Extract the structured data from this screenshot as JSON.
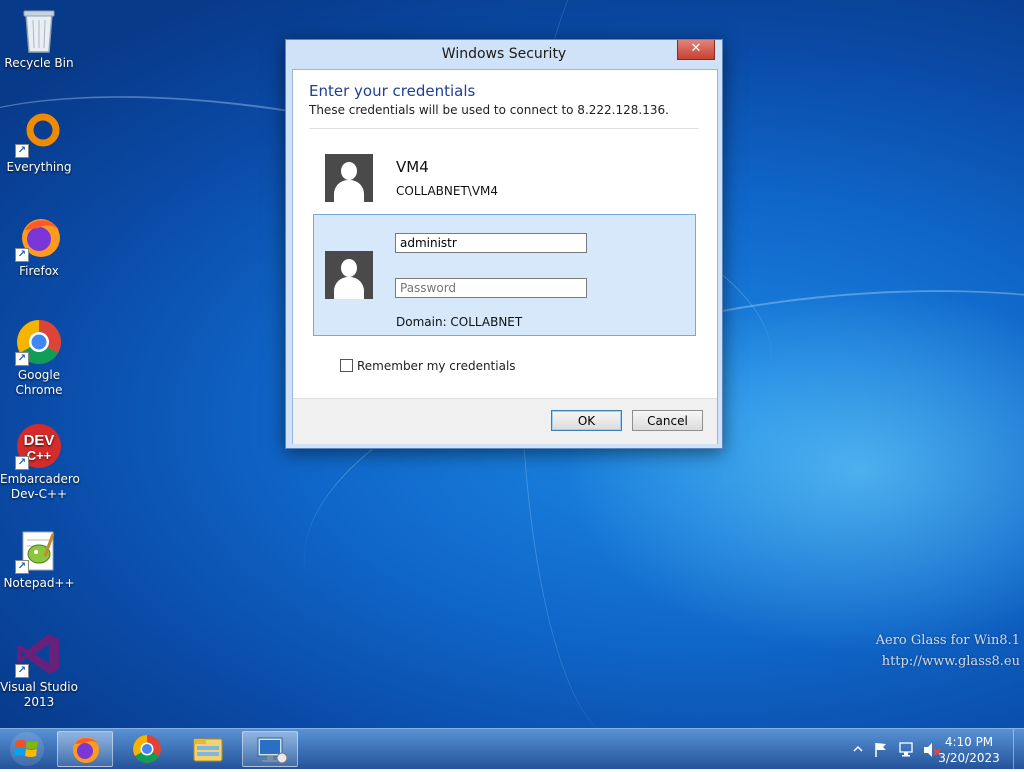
{
  "desktop": {
    "icons": [
      {
        "label": "Recycle Bin"
      },
      {
        "label": "Everything"
      },
      {
        "label": "Firefox"
      },
      {
        "label": "Google Chrome"
      },
      {
        "label": "Embarcadero Dev-C++"
      },
      {
        "label": "Notepad++"
      },
      {
        "label": "Visual Studio 2013"
      }
    ],
    "watermark": {
      "line1": "Aero Glass for Win8.1",
      "line2": "http://www.glass8.eu"
    }
  },
  "dialog": {
    "title": "Windows Security",
    "close_label": "✕",
    "heading": "Enter your credentials",
    "subtext": "These credentials will be used to connect to 8.222.128.136.",
    "account": {
      "name": "VM4",
      "domain_user": "COLLABNET\\VM4"
    },
    "form": {
      "username_value": "administr",
      "password_placeholder": "Password",
      "domain_label": "Domain: COLLABNET"
    },
    "remember_label": "Remember my credentials",
    "remember_checked": false,
    "ok_label": "OK",
    "cancel_label": "Cancel"
  },
  "taskbar": {
    "pinned": [
      {
        "icon": "firefox-icon",
        "active": true
      },
      {
        "icon": "chrome-icon",
        "active": false
      },
      {
        "icon": "file-explorer-icon",
        "active": false
      },
      {
        "icon": "remote-desktop-icon",
        "active": true
      }
    ],
    "clock": {
      "time": "4:10 PM",
      "date": "3/20/2023"
    },
    "tray_icons": [
      "show-hidden-icons-chevron-icon",
      "action-center-flag-icon",
      "network-icon",
      "volume-muted-icon"
    ]
  },
  "colors": {
    "desktop_blue": "#0f66c9",
    "dialog_heading": "#1f3f93",
    "close_red": "#c74132",
    "selected_panel": "#d7e8fb"
  }
}
